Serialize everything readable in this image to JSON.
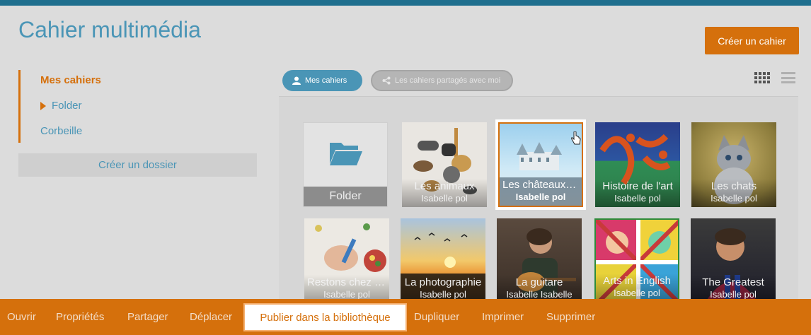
{
  "header": {
    "title": "Cahier multimédia",
    "create_label": "Créer un cahier"
  },
  "sidebar": {
    "items": [
      {
        "label": "Mes cahiers"
      },
      {
        "label": "Folder"
      },
      {
        "label": "Corbeille"
      }
    ],
    "create_folder_label": "Créer un dossier"
  },
  "filters": {
    "mine_label": "Mes cahiers",
    "shared_label": "Les cahiers partagés avec moi"
  },
  "notebooks": {
    "folder_label": "Folder",
    "items": [
      {
        "title": "Les animaux",
        "author": "Isabelle pol"
      },
      {
        "title": "Les châteaux de la Loire",
        "author": "Isabelle pol"
      },
      {
        "title": "Histoire de l'art",
        "author": "Isabelle pol"
      },
      {
        "title": "Les chats",
        "author": "Isabelle pol"
      },
      {
        "title": "Restons chez nous",
        "author": "Isabelle pol"
      },
      {
        "title": "La photographie",
        "author": "Isabelle pol"
      },
      {
        "title": "La guitare",
        "author": "Isabelle Isabelle"
      },
      {
        "title": "Arts in English",
        "author": "Isabelle pol"
      },
      {
        "title": "The Greatest",
        "author": "Isabelle pol"
      }
    ]
  },
  "actions": {
    "items": [
      "Ouvrir",
      "Propriétés",
      "Partager",
      "Déplacer",
      "Publier dans la bibliothèque",
      "Dupliquer",
      "Imprimer",
      "Supprimer"
    ]
  },
  "colors": {
    "accent": "#d5700c",
    "brand_blue": "#4a95b6",
    "topbar": "#1f6f8e"
  }
}
